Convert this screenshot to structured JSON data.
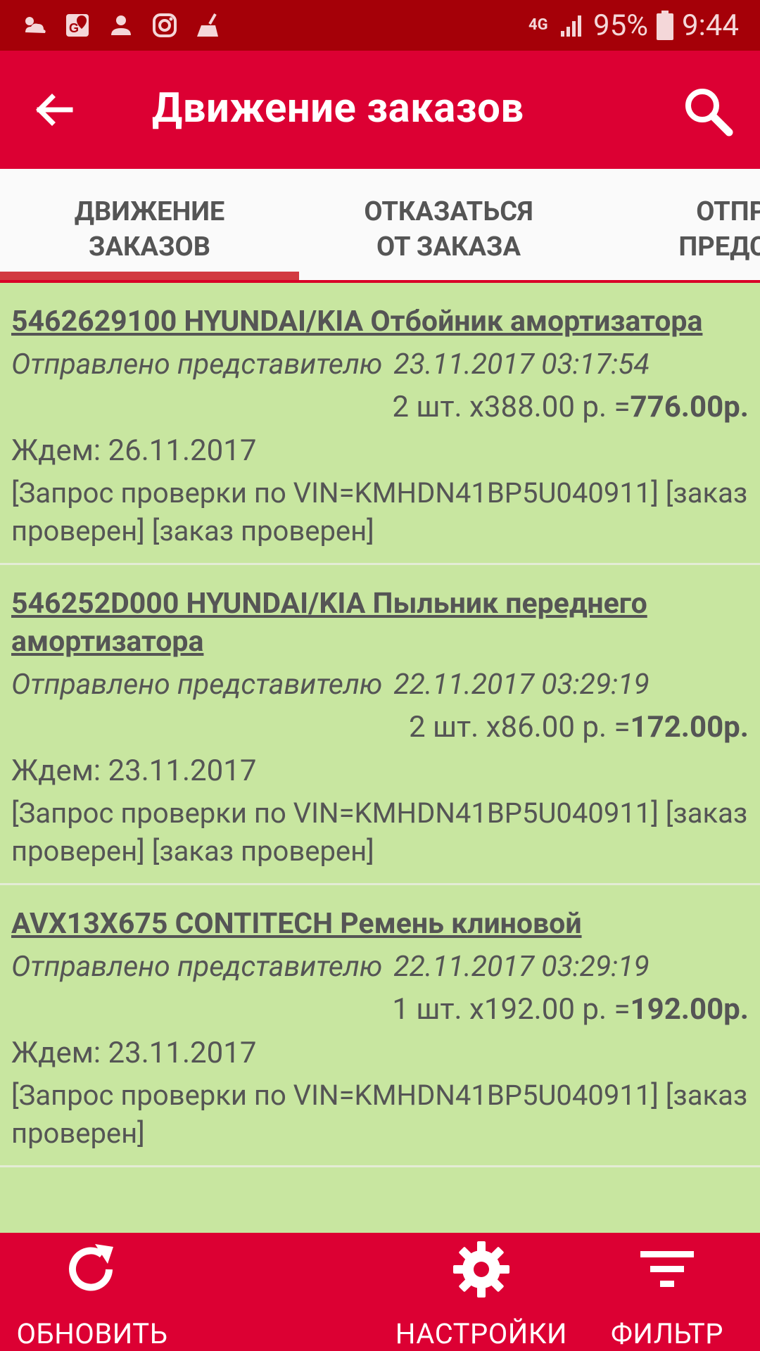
{
  "status_bar": {
    "network": "4G",
    "battery": "95%",
    "time": "9:44",
    "left_icons": [
      "weather-icon",
      "maps-icon",
      "account-icon",
      "instagram-icon",
      "broom-icon"
    ]
  },
  "app_bar": {
    "title": "Движение заказов"
  },
  "tabs": [
    {
      "label_line1": "ДВИЖЕНИЕ",
      "label_line2": "ЗАКАЗОВ",
      "selected": true
    },
    {
      "label_line1": "ОТКАЗАТЬСЯ",
      "label_line2": "ОТ ЗАКАЗА",
      "selected": false
    },
    {
      "label_line1": "ОТПРАВ",
      "label_line2": "ПРЕДСТАВ",
      "selected": false
    }
  ],
  "orders": [
    {
      "title": "5462629100 HYUNDAI/KIA Отбойник амортизатора ",
      "status": "Отправлено представителю",
      "datetime": "23.11.2017 03:17:54",
      "quantity_price": "2 шт. x388.00 р. =",
      "total": "776.00р.",
      "wait": "Ждем: 26.11.2017",
      "note": "[Запрос проверки по VIN=KMHDN41BP5U040911] [заказ проверен] [заказ проверен]"
    },
    {
      "title": "546252D000 HYUNDAI/KIA Пыльник переднего амортизатора ",
      "status": "Отправлено представителю",
      "datetime": "22.11.2017 03:29:19",
      "quantity_price": "2 шт. x86.00 р. =",
      "total": "172.00р.",
      "wait": "Ждем: 23.11.2017",
      "note": "[Запрос проверки по VIN=KMHDN41BP5U040911] [заказ проверен] [заказ проверен]"
    },
    {
      "title": "AVX13X675 CONTITECH Ремень клиновой ",
      "status": "Отправлено представителю",
      "datetime": "22.11.2017 03:29:19",
      "quantity_price": "1 шт. x192.00 р. =",
      "total": "192.00р.",
      "wait": "Ждем: 23.11.2017",
      "note": "[Запрос проверки по VIN=KMHDN41BP5U040911] [заказ проверен]"
    }
  ],
  "bottom_bar": {
    "refresh_label": "ОБНОВИТЬ",
    "settings_label": "НАСТРОЙКИ",
    "filter_label": "ФИЛЬТР"
  },
  "colors": {
    "status_bar": "#a50008",
    "app_bar": "#dc0033",
    "list_bg": "#c8e6a0",
    "tab_indicator": "#d23a40"
  }
}
